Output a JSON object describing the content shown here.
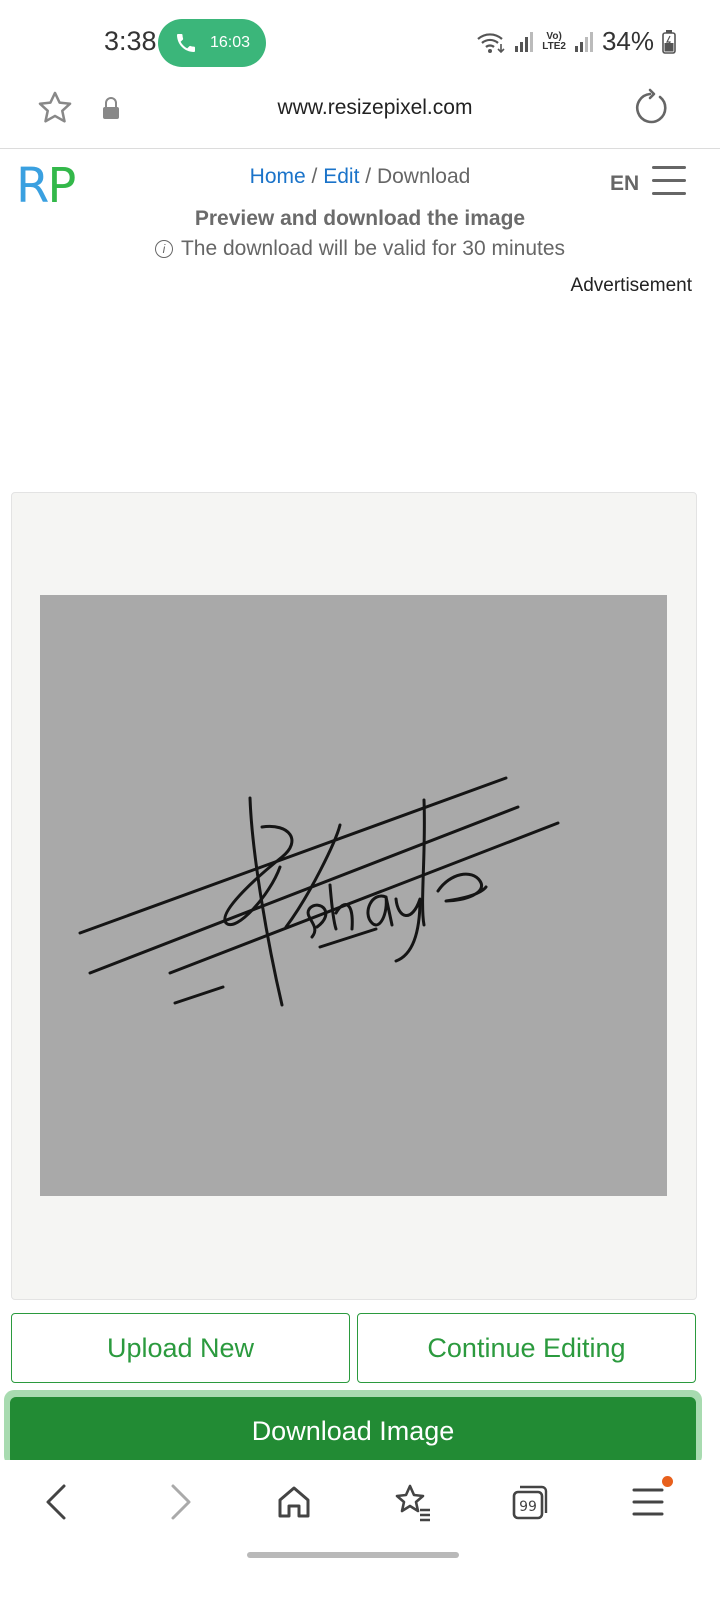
{
  "status_bar": {
    "time": "3:38",
    "call_timer": "16:03",
    "volte_label": "Vo)",
    "lte_label": "LTE2",
    "battery": "34%"
  },
  "browser": {
    "url": "www.resizepixel.com"
  },
  "site": {
    "logo": {
      "r": "R",
      "p": "P"
    },
    "breadcrumb": {
      "home": "Home",
      "sep1": "/",
      "edit": "Edit",
      "sep2": "/",
      "current": "Download"
    },
    "language": "EN",
    "subtitle": "Preview and download the image",
    "note": "The download will be valid for 30 minutes",
    "advertisement": "Advertisement"
  },
  "buttons": {
    "upload_new": "Upload New",
    "continue_editing": "Continue Editing",
    "download_image": "Download Image"
  },
  "colors": {
    "accent_green": "#228b34",
    "link_blue": "#1a73c9",
    "logo_blue": "#3aa0e0",
    "logo_green": "#33b84a",
    "call_green": "#3bb67a",
    "notification_orange": "#e8601c"
  }
}
